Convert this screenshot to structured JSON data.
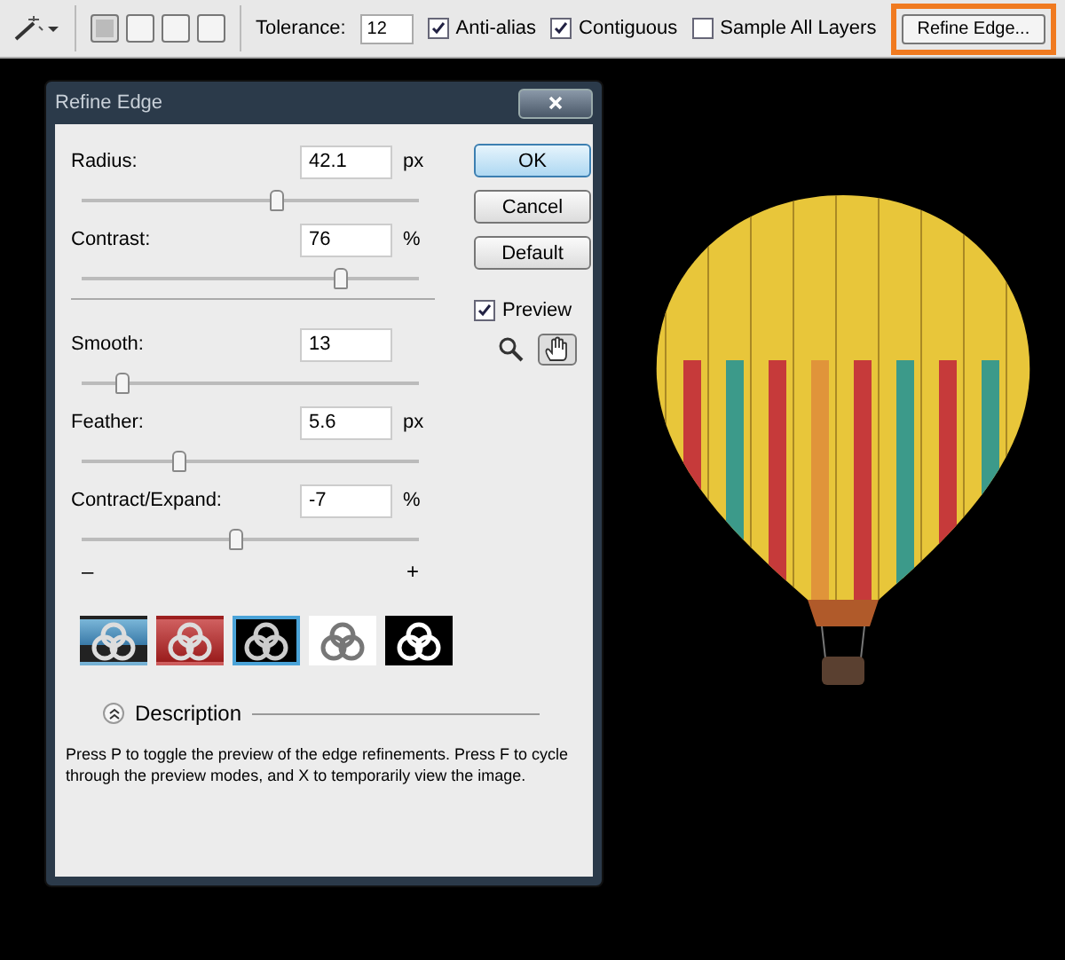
{
  "toolbar": {
    "modes": [
      {
        "selected": true
      },
      {
        "selected": false
      },
      {
        "selected": false
      },
      {
        "selected": false
      }
    ],
    "tolerance": {
      "label": "Tolerance:",
      "value": "12"
    },
    "options": [
      {
        "label": "Anti-alias",
        "checked": true
      },
      {
        "label": "Contiguous",
        "checked": true
      },
      {
        "label": "Sample All Layers",
        "checked": false
      }
    ],
    "refine_button": {
      "label": "Refine Edge...",
      "highlighted": true
    }
  },
  "dialog": {
    "title": "Refine Edge",
    "groups": [
      [
        {
          "label": "Radius:",
          "value": "42.1",
          "unit": "px",
          "level": 0.58
        },
        {
          "label": "Contrast:",
          "value": "76",
          "unit": "%",
          "level": 0.77
        }
      ],
      [
        {
          "label": "Smooth:",
          "value": "13",
          "level": 0.12
        },
        {
          "label": "Feather:",
          "value": "5.6",
          "unit": "px",
          "level": 0.29
        },
        {
          "label": "Contract/Expand:",
          "value": "-7",
          "unit": "%",
          "level": 0.46
        }
      ]
    ],
    "range_min": "–",
    "range_max": "+",
    "buttons": [
      {
        "label": "OK",
        "default": true
      },
      {
        "label": "Cancel",
        "default": false
      },
      {
        "label": "Default",
        "default": false
      }
    ],
    "preview": {
      "label": "Preview",
      "checked": true
    },
    "tools": [
      {
        "kind": "zoom",
        "selected": false
      },
      {
        "kind": "hand",
        "selected": true
      }
    ],
    "view_modes": [
      {
        "kind": "overlay",
        "selected": false
      },
      {
        "kind": "red",
        "selected": false
      },
      {
        "kind": "black",
        "selected": true
      },
      {
        "kind": "white",
        "selected": false
      },
      {
        "kind": "mask",
        "selected": false
      }
    ],
    "description": {
      "label": "Description",
      "expanded": true,
      "text": "Press P to toggle the preview of the edge refinements. Press F to cycle through the preview modes, and X to temporarily view the image."
    }
  }
}
